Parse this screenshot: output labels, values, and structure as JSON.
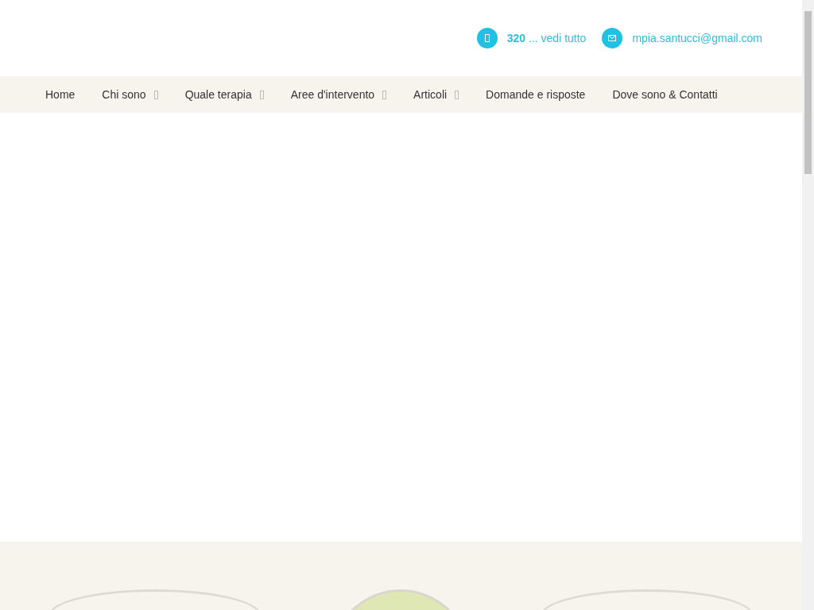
{
  "header": {
    "contacts": [
      {
        "kind": "phone",
        "bold": "320",
        "text": " ... vedi tutto"
      },
      {
        "kind": "email",
        "text": "mpia.santucci@gmail.com"
      }
    ]
  },
  "nav": {
    "items": [
      {
        "label": "Home",
        "submenu": false
      },
      {
        "label": "Chi sono",
        "submenu": true
      },
      {
        "label": "Quale terapia",
        "submenu": true
      },
      {
        "label": "Aree d'intervento",
        "submenu": true
      },
      {
        "label": "Articoli",
        "submenu": true
      },
      {
        "label": "Domande e risposte",
        "submenu": false
      },
      {
        "label": "Dove sono & Contatti",
        "submenu": false
      }
    ]
  },
  "features": {
    "items": [
      {
        "kind": "ring"
      },
      {
        "kind": "picture"
      },
      {
        "kind": "ring"
      }
    ]
  }
}
